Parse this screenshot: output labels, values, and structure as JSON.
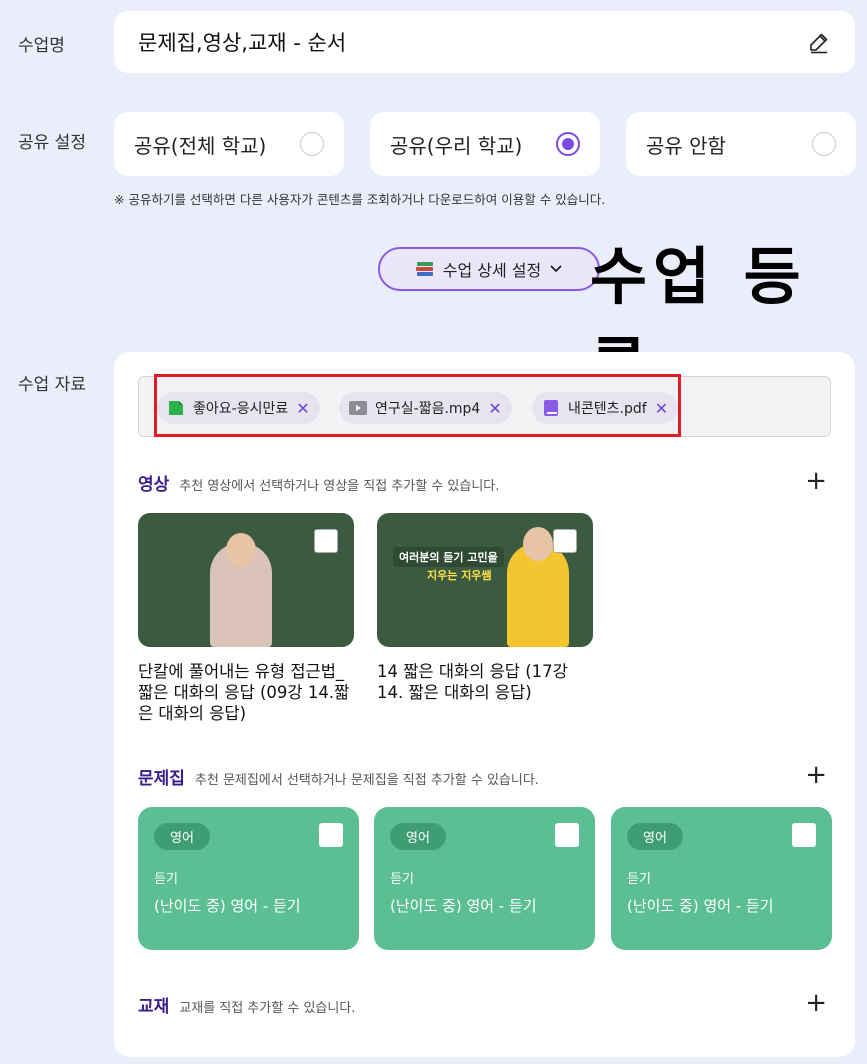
{
  "lesson_name": {
    "label": "수업명",
    "value": "문제집,영상,교재 - 순서"
  },
  "share": {
    "label": "공유 설정",
    "options": [
      {
        "label": "공유(전체 학교)",
        "checked": false
      },
      {
        "label": "공유(우리 학교)",
        "checked": true
      },
      {
        "label": "공유 안함",
        "checked": false
      }
    ],
    "note": "※ 공유하기를 선택하면 다른 사용자가 콘텐츠를 조회하거나 다운로드하여 이용할 수 있습니다."
  },
  "detail_button": {
    "icon": "books-icon",
    "label": "수업 상세 설정"
  },
  "overlay_title": "수업 등록",
  "materials": {
    "label": "수업 자료",
    "chips": [
      {
        "icon": "note-icon",
        "color": "#2bb24c",
        "label": "좋아요-응시만료"
      },
      {
        "icon": "video-icon",
        "color": "#8d8d95",
        "label": "연구실-짧음.mp4"
      },
      {
        "icon": "book-icon",
        "color": "#8a5be6",
        "label": "내콘텐츠.pdf"
      }
    ],
    "video_section": {
      "title": "영상",
      "desc": "추천 영상에서 선택하거나 영상을 직접 추가할 수 있습니다.",
      "videos": [
        {
          "title": "단칼에 풀어내는 유형 접근법_ 짧은 대화의 응답 (09강 14.짧은 대화의 응답)"
        },
        {
          "title": "14 짧은 대화의 응답 (17강 14. 짧은 대화의 응답)",
          "board_line1": "여러분의 듣기 고민을",
          "board_line2": "지우는 지우쌤"
        }
      ]
    },
    "workbook_section": {
      "title": "문제집",
      "desc": "추천 문제집에서 선택하거나 문제집을 직접 추가할 수 있습니다.",
      "books": [
        {
          "badge": "영어",
          "sub": "듣기",
          "name": "(난이도 중) 영어 - 듣기"
        },
        {
          "badge": "영어",
          "sub": "듣기",
          "name": "(난이도 중) 영어 - 듣기"
        },
        {
          "badge": "영어",
          "sub": "듣기",
          "name": "(난이도 중) 영어 - 듣기"
        }
      ]
    },
    "textbook_section": {
      "title": "교재",
      "desc": "교재를 직접 추가할 수 있습니다."
    }
  },
  "colors": {
    "accent": "#7b4be0",
    "workbook_card": "#5bbf93",
    "highlight_box": "#e01b24"
  }
}
